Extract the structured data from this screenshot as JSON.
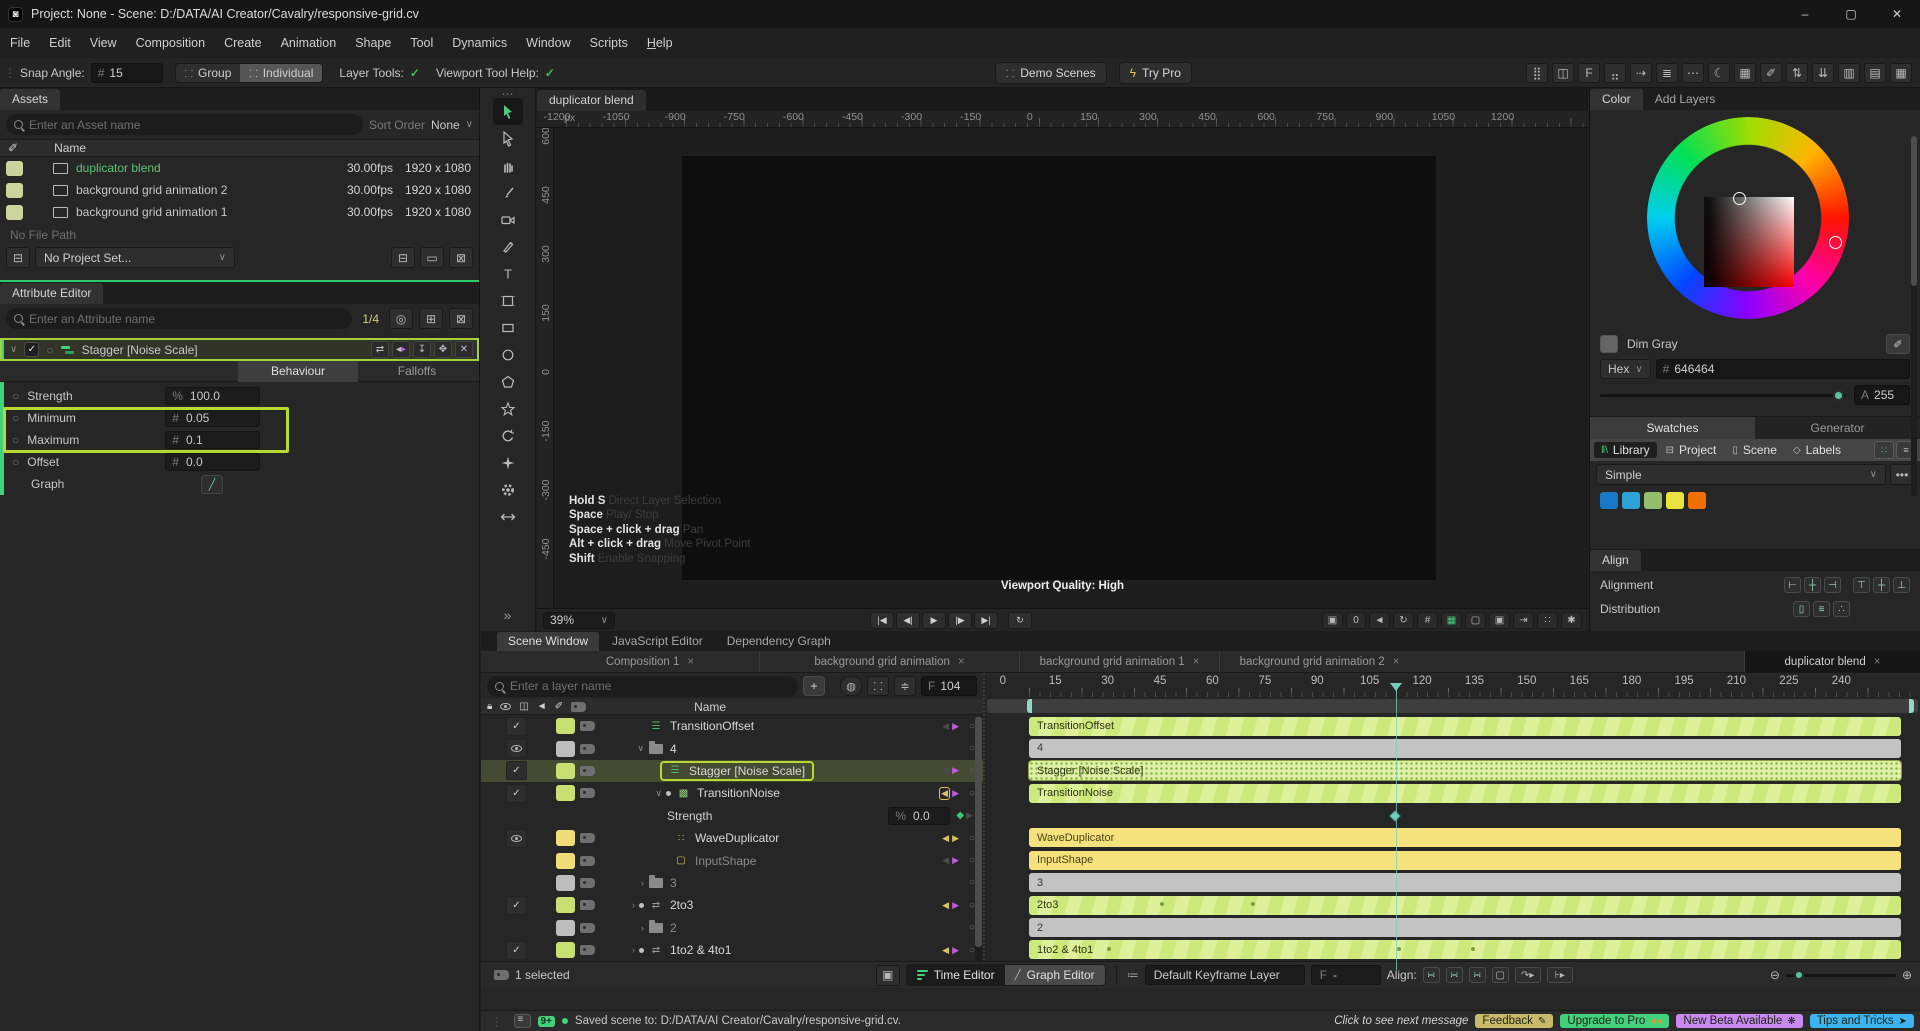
{
  "window": {
    "title": "Project: None - Scene: D:/DATA/AI Creator/Cavalry/responsive-grid.cv",
    "minimize": "–",
    "maximize": "▢",
    "close": "✕"
  },
  "menu": [
    "File",
    "Edit",
    "View",
    "Composition",
    "Create",
    "Animation",
    "Shape",
    "Tool",
    "Dynamics",
    "Window",
    "Scripts",
    "Help"
  ],
  "toolbar": {
    "snap_angle_label": "Snap Angle:",
    "snap_angle_unit": "#",
    "snap_angle_value": "15",
    "group_label": "Group",
    "individual_label": "Individual",
    "layer_tools_label": "Layer Tools:",
    "layer_tools_check": "✓",
    "viewport_help_label": "Viewport Tool Help:",
    "viewport_help_check": "✓",
    "demo_scenes_label": "Demo Scenes",
    "try_pro_label": "Try Pro",
    "right_icons": [
      {
        "name": "grid-dots-icon",
        "glyph": "⣿"
      },
      {
        "name": "cube-icon",
        "glyph": "◫"
      },
      {
        "name": "frame-icon",
        "glyph": "F"
      },
      {
        "name": "dots-icon",
        "glyph": "⣤"
      },
      {
        "name": "dashed-arrow-icon",
        "glyph": "⇢"
      },
      {
        "name": "list-icon",
        "glyph": "≣"
      },
      {
        "name": "more-icon",
        "glyph": "⋯"
      },
      {
        "name": "moon-icon",
        "glyph": "☾"
      },
      {
        "name": "table-icon",
        "glyph": "▦"
      },
      {
        "name": "pen-icon",
        "glyph": "✐"
      },
      {
        "name": "sort-up-icon",
        "glyph": "⇅"
      },
      {
        "name": "sort-down-icon",
        "glyph": "⇊"
      },
      {
        "name": "columns-icon",
        "glyph": "▥"
      },
      {
        "name": "rows-icon",
        "glyph": "▤"
      },
      {
        "name": "grid-icon",
        "glyph": "▦"
      }
    ]
  },
  "assets": {
    "tab": "Assets",
    "search_placeholder": "Enter an Asset name",
    "sort_label": "Sort Order",
    "sort_value": "None",
    "name_header": "Name",
    "items": [
      {
        "name": "duplicator blend",
        "fps": "30.00fps",
        "size": "1920 x 1080",
        "cls": "sel"
      },
      {
        "name": "background grid animation 2",
        "fps": "30.00fps",
        "size": "1920 x 1080"
      },
      {
        "name": "background grid animation 1",
        "fps": "30.00fps",
        "size": "1920 x 1080"
      }
    ],
    "no_file_path": "No File Path",
    "project_select": "No Project Set..."
  },
  "attr": {
    "tab": "Attribute Editor",
    "search_placeholder": "Enter an Attribute name",
    "pager": "1/4",
    "header_title": "Stagger [Noise Scale]",
    "tab_behaviour": "Behaviour",
    "tab_falloffs": "Falloffs",
    "rows": [
      {
        "label": "Strength",
        "unit": "%",
        "value": "100.0"
      },
      {
        "label": "Minimum",
        "unit": "#",
        "value": "0.05"
      },
      {
        "label": "Maximum",
        "unit": "#",
        "value": "0.1"
      },
      {
        "label": "Offset",
        "unit": "#",
        "value": "0.0"
      }
    ],
    "graph_label": "Graph"
  },
  "tools": [
    "select",
    "direct-select",
    "pan",
    "brush",
    "camera",
    "pen",
    "text",
    "artboard",
    "rectangle",
    "ellipse",
    "polygon",
    "star",
    "rotate",
    "sparkle",
    "settings",
    "resize"
  ],
  "viewport": {
    "tab": "duplicator blend",
    "ruler_unit": "px",
    "h_ruler": [
      "-1200",
      "-1050",
      "-900",
      "-750",
      "-600",
      "-450",
      "-300",
      "-150",
      "0",
      "150",
      "300",
      "450",
      "600",
      "750",
      "900",
      "1050",
      "1200"
    ],
    "v_ruler": [
      "600",
      "450",
      "300",
      "150",
      "0",
      "-150",
      "-300",
      "-450"
    ],
    "hints": [
      {
        "key": "Hold S",
        "desc": "Direct Layer Selection"
      },
      {
        "key": "Space",
        "desc": "Play/ Stop"
      },
      {
        "key": "Space + click + drag",
        "desc": "Pan"
      },
      {
        "key": "Alt + click + drag",
        "desc": "Move Pivot Point"
      },
      {
        "key": "Shift",
        "desc": "Enable Snapping"
      }
    ],
    "quality": "Viewport Quality: High",
    "zoom": "39%",
    "camera_value": "0"
  },
  "color": {
    "tab_color": "Color",
    "tab_add_layers": "Add Layers",
    "color_name": "Dim Gray",
    "mode": "Hex",
    "hex_prefix": "#",
    "hex_value": "646464",
    "alpha_label": "A",
    "alpha_value": "255",
    "tab_swatches": "Swatches",
    "tab_generator": "Generator",
    "lib_library": "Library",
    "lib_project": "Project",
    "lib_scene": "Scene",
    "lib_labels": "Labels",
    "set_name": "Simple",
    "more": "•••",
    "swatches": [
      "#1878c8",
      "#2ba2d8",
      "#94bd6e",
      "#eae23e",
      "#f07000"
    ]
  },
  "align": {
    "tab": "Align",
    "alignment_label": "Alignment",
    "distribution_label": "Distribution",
    "alignment_icons": [
      "align-left",
      "align-center-h",
      "align-right",
      "align-top",
      "align-middle",
      "align-bottom"
    ],
    "distribution_icons": [
      "distribute-h",
      "distribute-v",
      "distribute-grid"
    ]
  },
  "bottom": {
    "tabs": [
      {
        "label": "Scene Window",
        "cls": "active"
      },
      {
        "label": "JavaScript Editor"
      },
      {
        "label": "Dependency Graph"
      }
    ],
    "comp_tabs": [
      {
        "label": "Composition 1"
      },
      {
        "label": "background grid animation"
      },
      {
        "label": "background grid animation 1"
      },
      {
        "label": "background grid animation 2"
      },
      {
        "label": "duplicator blend",
        "cls": "active"
      }
    ],
    "search_placeholder": "Enter a layer name",
    "frame_label": "F",
    "frame_value": "104",
    "name_header": "Name",
    "selected_info": "1 selected",
    "time_editor": "Time Editor",
    "graph_editor": "Graph Editor",
    "keyframe_layer": "Default Keyframe Layer",
    "frame2_label": "F",
    "frame2_value": "-",
    "align_label": "Align:"
  },
  "layers": [
    {
      "label": "TransitionOffset",
      "icon": "stagger",
      "state": "enabled"
    },
    {
      "label": "4",
      "icon": "folder",
      "state": "visible"
    },
    {
      "label": "Stagger [Noise Scale]",
      "icon": "stagger",
      "state": "enabled",
      "selected": true
    },
    {
      "label": "TransitionNoise",
      "icon": "noise",
      "state": "enabled"
    },
    {
      "label": "Strength",
      "icon": "attribute",
      "unit": "%",
      "value": "0.0"
    },
    {
      "label": "WaveDuplicator",
      "icon": "duplicator",
      "state": "visible"
    },
    {
      "label": "InputShape",
      "icon": "shape",
      "state": "hidden"
    },
    {
      "label": "3",
      "icon": "folder"
    },
    {
      "label": "2to3",
      "icon": "remap",
      "state": "enabled"
    },
    {
      "label": "2",
      "icon": "folder"
    },
    {
      "label": "1to2 & 4to1",
      "icon": "remap",
      "state": "enabled"
    }
  ],
  "timeline": {
    "ruler": [
      "0",
      "15",
      "30",
      "45",
      "60",
      "75",
      "90",
      "105",
      "120",
      "135",
      "150",
      "165",
      "180",
      "195",
      "210",
      "225",
      "240"
    ],
    "playhead_frame": 105,
    "bars": [
      {
        "label": "TransitionOffset",
        "style": "stripes"
      },
      {
        "label": "4",
        "style": "gray"
      },
      {
        "label": "Stagger [Noise Scale]",
        "style": "dots"
      },
      {
        "label": "TransitionNoise",
        "style": "stripes"
      },
      {
        "label": "",
        "style": "empty",
        "keyframes": [
          105
        ]
      },
      {
        "label": "WaveDuplicator",
        "style": "yellow"
      },
      {
        "label": "InputShape",
        "style": "yellow"
      },
      {
        "label": "3",
        "style": "gray"
      },
      {
        "label": "2to3",
        "style": "stripes",
        "markers": [
          38,
          64
        ]
      },
      {
        "label": "2",
        "style": "gray"
      },
      {
        "label": "1to2 & 4to1",
        "style": "stripes",
        "markers": [
          23,
          106,
          127
        ]
      }
    ]
  },
  "status": {
    "count_badge": "9+",
    "message": "Saved scene to: D:/DATA/AI Creator/Cavalry/responsive-grid.cv.",
    "next_message": "Click to see next message",
    "badges": [
      {
        "label": "Feedback",
        "color": "#c9ba6a",
        "icon": "pencil-icon"
      },
      {
        "label": "Upgrade to Pro",
        "color": "#43d17c",
        "icon": "eyes-icon"
      },
      {
        "label": "New Beta Available",
        "color": "#c98af0",
        "icon": "party-icon"
      },
      {
        "label": "Tips and Tricks",
        "color": "#3cb4ef",
        "icon": "rocket-icon"
      }
    ]
  }
}
